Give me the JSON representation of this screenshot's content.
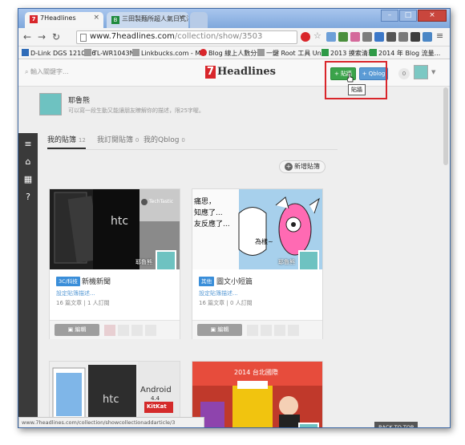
{
  "browser": {
    "tabs": [
      {
        "title": "7Headlines",
        "active": true
      },
      {
        "title": "三田製麵所超人氣日式沾麵",
        "active": false
      }
    ],
    "address": {
      "host": "www.7headlines.com",
      "path": "/collection/show/3503"
    },
    "bookmarks": [
      {
        "label": "D-Link DGS 1210-16"
      },
      {
        "label": "TL-WR1043N"
      },
      {
        "label": "Linkbucks.com - M..."
      },
      {
        "label": "Blog 線上人數分佈"
      },
      {
        "label": "一鍵 Root 工具 Unl..."
      },
      {
        "label": "2013 摸索清單"
      },
      {
        "label": "2014 年 Blog 流量..."
      }
    ],
    "status_url": "www.7headlines.com/collection/showcollectionaddarticle/3"
  },
  "site": {
    "search_placeholder": "輸入關鍵字...",
    "logo_badge": "7",
    "logo_text": "Headlines",
    "share_button": "+ 貼牆",
    "qblog_button": "+ Qblog",
    "tooltip": "貼牆",
    "notif_count": "0",
    "profile": {
      "name": "耶魯熊",
      "description": "可以寫一段生動又能讓朋友瞭解你的描述，限25字喔。"
    },
    "tabs": [
      {
        "label": "我的貼簿",
        "count": "12",
        "active": true
      },
      {
        "label": "我訂閱貼簿",
        "count": "0",
        "active": false
      },
      {
        "label": "我的Qblog",
        "count": "0",
        "active": false
      }
    ],
    "add_button": "新增貼簿",
    "cards": [
      {
        "tag": "3C/科技",
        "title": "新機新聞",
        "desc": "設定貼簿描述...",
        "meta": "16 篇文章 | 1 人訂閱",
        "owner": "耶魯熊",
        "edit": "編輯"
      },
      {
        "tag": "其他",
        "title": "圖文小短篇",
        "desc": "設定貼簿描述...",
        "meta": "16 篇文章 | 0 人訂閱",
        "owner": "耶魯熊",
        "edit": "編輯"
      },
      {
        "tag": "",
        "title": "",
        "desc": "",
        "meta": "",
        "owner": "",
        "edit": ""
      },
      {
        "tag": "",
        "title": "",
        "desc": "",
        "meta": "",
        "owner": "",
        "edit": ""
      }
    ],
    "thumb_text": {
      "brand_a": "htc",
      "brand_b": "TechTastic",
      "comic_line1": "痛思，",
      "comic_line2": "知應了...",
      "comic_line3": "友反應了...",
      "comic_word": "為樣~",
      "android": "Android",
      "android_ver": "4.4",
      "kitkat": "KitKat",
      "expo": "2014 台北國際"
    },
    "back_to_top": "BACK TO TOP"
  }
}
